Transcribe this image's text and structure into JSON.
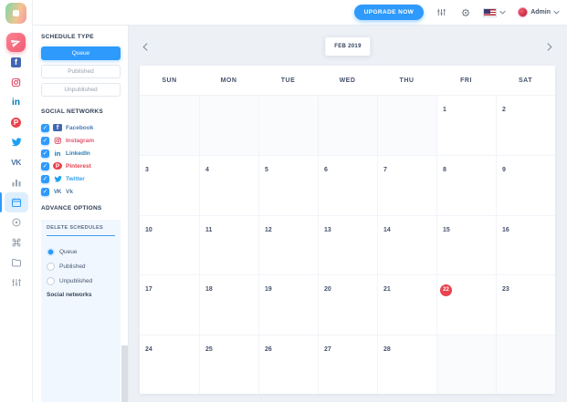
{
  "topbar": {
    "upgrade_button": "UPGRADE NOW",
    "admin_label": "Admin",
    "icons": {
      "filters": "sliders-icon",
      "settings": "gear-icon",
      "language": "us-flag-icon",
      "user": "avatar",
      "expand": "caret-down-icon"
    }
  },
  "rail": {
    "items": [
      "app-logo",
      "publish-paper-plane",
      "facebook",
      "instagram",
      "linkedin",
      "pinterest",
      "twitter",
      "vk",
      "bar-chart",
      "calendar",
      "target",
      "command",
      "folder",
      "sliders"
    ],
    "active_item": "calendar"
  },
  "sidebar": {
    "schedule_type_title": "SCHEDULE TYPE",
    "schedule_types": [
      {
        "label": "Queue",
        "active": true
      },
      {
        "label": "Published",
        "active": false
      },
      {
        "label": "Unpublished",
        "active": false
      }
    ],
    "social_networks_title": "SOCIAL NETWORKS",
    "social_networks": [
      {
        "label": "Facebook",
        "checked": true,
        "color": "#4a7ab5"
      },
      {
        "label": "Instagram",
        "checked": true,
        "color": "#e1566e"
      },
      {
        "label": "LinkedIn",
        "checked": true,
        "color": "#2d7eb5"
      },
      {
        "label": "Pinterest",
        "checked": true,
        "color": "#e8434e"
      },
      {
        "label": "Twitter",
        "checked": true,
        "color": "#3aa3e8"
      },
      {
        "label": "Vk",
        "checked": true,
        "color": "#57759c"
      }
    ],
    "advance_options_title": "ADVANCE OPTIONS",
    "delete_schedules": {
      "title": "DELETE SCHEDULES",
      "options": [
        {
          "label": "Queue",
          "selected": true
        },
        {
          "label": "Published",
          "selected": false
        },
        {
          "label": "Unpublished",
          "selected": false
        }
      ],
      "footer_label": "Social networks"
    }
  },
  "calendar": {
    "month_label": "FEB 2019",
    "day_names": [
      "SUN",
      "MON",
      "TUE",
      "WED",
      "THU",
      "FRI",
      "SAT"
    ],
    "cells": [
      "",
      "",
      "",
      "",
      "",
      "1",
      "2",
      "3",
      "4",
      "5",
      "6",
      "7",
      "8",
      "9",
      "10",
      "11",
      "12",
      "13",
      "14",
      "15",
      "16",
      "17",
      "18",
      "19",
      "20",
      "21",
      "22",
      "23",
      "24",
      "25",
      "26",
      "27",
      "28",
      "",
      ""
    ],
    "today_date": "22"
  },
  "colors": {
    "accent_blue": "#2e9afc",
    "today_red": "#e8434e",
    "background": "#edf0f5",
    "panel_blue": "#f1f7fe"
  }
}
